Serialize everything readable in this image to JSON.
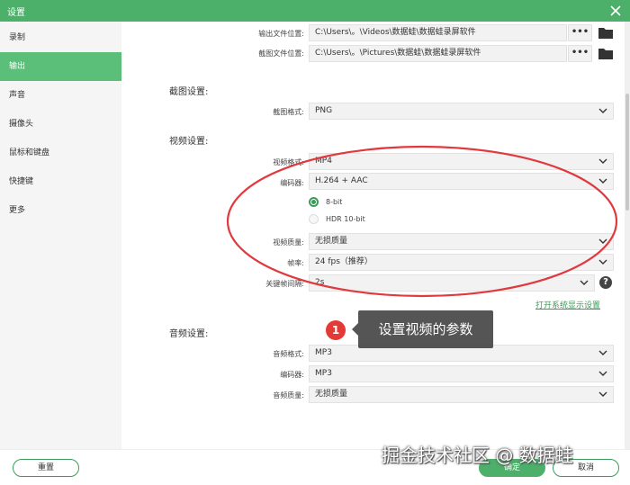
{
  "window": {
    "title": "设置"
  },
  "sidebar": {
    "items": [
      {
        "label": "录制"
      },
      {
        "label": "输出"
      },
      {
        "label": "声音"
      },
      {
        "label": "摄像头"
      },
      {
        "label": "鼠标和键盘"
      },
      {
        "label": "快捷键"
      },
      {
        "label": "更多"
      }
    ]
  },
  "output": {
    "file_location_label": "输出文件位置:",
    "file_location_value": "C:\\Users\\。\\Videos\\数据蛙\\数据蛙录屏软件",
    "screenshot_location_label": "截图文件位置:",
    "screenshot_location_value": "C:\\Users\\。\\Pictures\\数据蛙\\数据蛙录屏软件",
    "browse_label": "•••"
  },
  "screenshot": {
    "section_title": "截图设置:",
    "format_label": "截图格式:",
    "format_value": "PNG"
  },
  "video": {
    "section_title": "视频设置:",
    "format_label": "视频格式:",
    "format_value": "MP4",
    "encoder_label": "编码器:",
    "encoder_value": "H.264 + AAC",
    "bitdepth_options": [
      "8-bit",
      "HDR 10-bit"
    ],
    "bitdepth_selected": "8-bit",
    "quality_label": "视频质量:",
    "quality_value": "无损质量",
    "framerate_label": "帧率:",
    "framerate_value": "24 fps（推荐）",
    "keyframe_label": "关键帧间隔:",
    "keyframe_value": "2s",
    "help_label": "?",
    "display_settings_link": "打开系统显示设置"
  },
  "audio": {
    "section_title": "音频设置:",
    "format_label": "音频格式:",
    "format_value": "MP3",
    "encoder_label": "编码器:",
    "encoder_value": "MP3",
    "quality_label": "音频质量:",
    "quality_value": "无损质量"
  },
  "footer": {
    "reset_label": "重置",
    "ok_label": "确定",
    "cancel_label": "取消"
  },
  "annotation": {
    "badge_number": "1",
    "tip_text": "设置视频的参数",
    "ellipse_color": "#e0393e"
  },
  "watermark": {
    "text": "掘金技术社区 @ 数据蛙"
  },
  "colors": {
    "accent": "#4caf6a",
    "active_item": "#5bbf7a",
    "link": "#3c9b59"
  }
}
